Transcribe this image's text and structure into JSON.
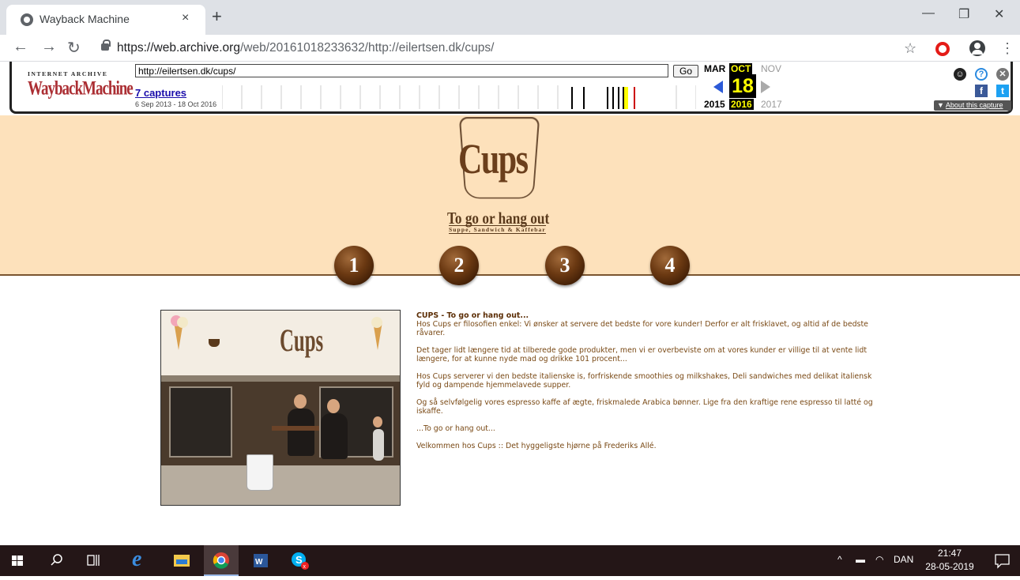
{
  "browser": {
    "tab_title": "Wayback Machine",
    "tab_close": "×",
    "new_tab": "+",
    "url_host": "https://web.archive.org",
    "url_path": "/web/20161018233632/http://eilertsen.dk/cups/",
    "window_controls": {
      "minimize": "—",
      "restore": "❐",
      "close": "✕"
    },
    "icons": [
      "back-icon",
      "forward-icon",
      "reload-icon",
      "lock-icon",
      "star-icon",
      "opera-icon",
      "profile-icon",
      "menu-icon"
    ]
  },
  "wayback": {
    "ia_label": "INTERNET ARCHIVE",
    "logo": "WaybackMachine",
    "url_input": "http://eilertsen.dk/cups/",
    "go_label": "Go",
    "captures_label": "7 captures",
    "capture_range": "6 Sep 2013 - 18 Oct 2016",
    "months": {
      "prev": "MAR",
      "current": "OCT",
      "next": "NOV"
    },
    "day": "18",
    "years": {
      "prev": "2015",
      "current": "2016",
      "next": "2017"
    },
    "about_label": "About this capture",
    "colors": {
      "highlight": "#ffff00",
      "logo_red": "#ab2e33",
      "prev_arrow": "#2c5ad7"
    }
  },
  "site": {
    "logo": "Cups",
    "tagline": "To go or hang out",
    "subtitle": "Suppe, Sandwich & Kaffebar",
    "nav": [
      "1",
      "2",
      "3",
      "4"
    ],
    "content_title": "CUPS - To go or hang out...",
    "paragraphs": [
      "Hos Cups er filosofien enkel: Vi ønsker at servere det bedste for vore kunder! Derfor er alt frisklavet, og altid af de bedste råvarer.",
      "Det tager lidt længere tid at tilberede gode produkter, men vi er overbeviste om at vores kunder er villige til at vente lidt længere, for at kunne nyde mad og drikke 101 procent...",
      "Hos Cups serverer vi den bedste italienske is, forfriskende smoothies og milkshakes, Deli sandwiches med delikat italiensk fyld og dampende hjemmelavede supper.",
      "Og så selvfølgelig vores espresso kaffe af ægte, friskmalede Arabica bønner. Lige fra den kraftige rene espresso til latté og iskaffe.",
      "...To go or hang out...",
      "Velkommen hos Cups :: Det hyggeligste hjørne på Frederiks Allé."
    ],
    "photo_sign": "Cups",
    "colors": {
      "hero_bg": "#fde1bb",
      "text": "#7a4a16",
      "brown": "#6b3f1c"
    }
  },
  "taskbar": {
    "apps": [
      "start-icon",
      "search-icon",
      "task-view-icon",
      "edge-icon",
      "file-explorer-icon",
      "chrome-icon",
      "word-icon",
      "skype-icon"
    ],
    "language": "DAN",
    "time": "21:47",
    "date": "28-05-2019"
  }
}
